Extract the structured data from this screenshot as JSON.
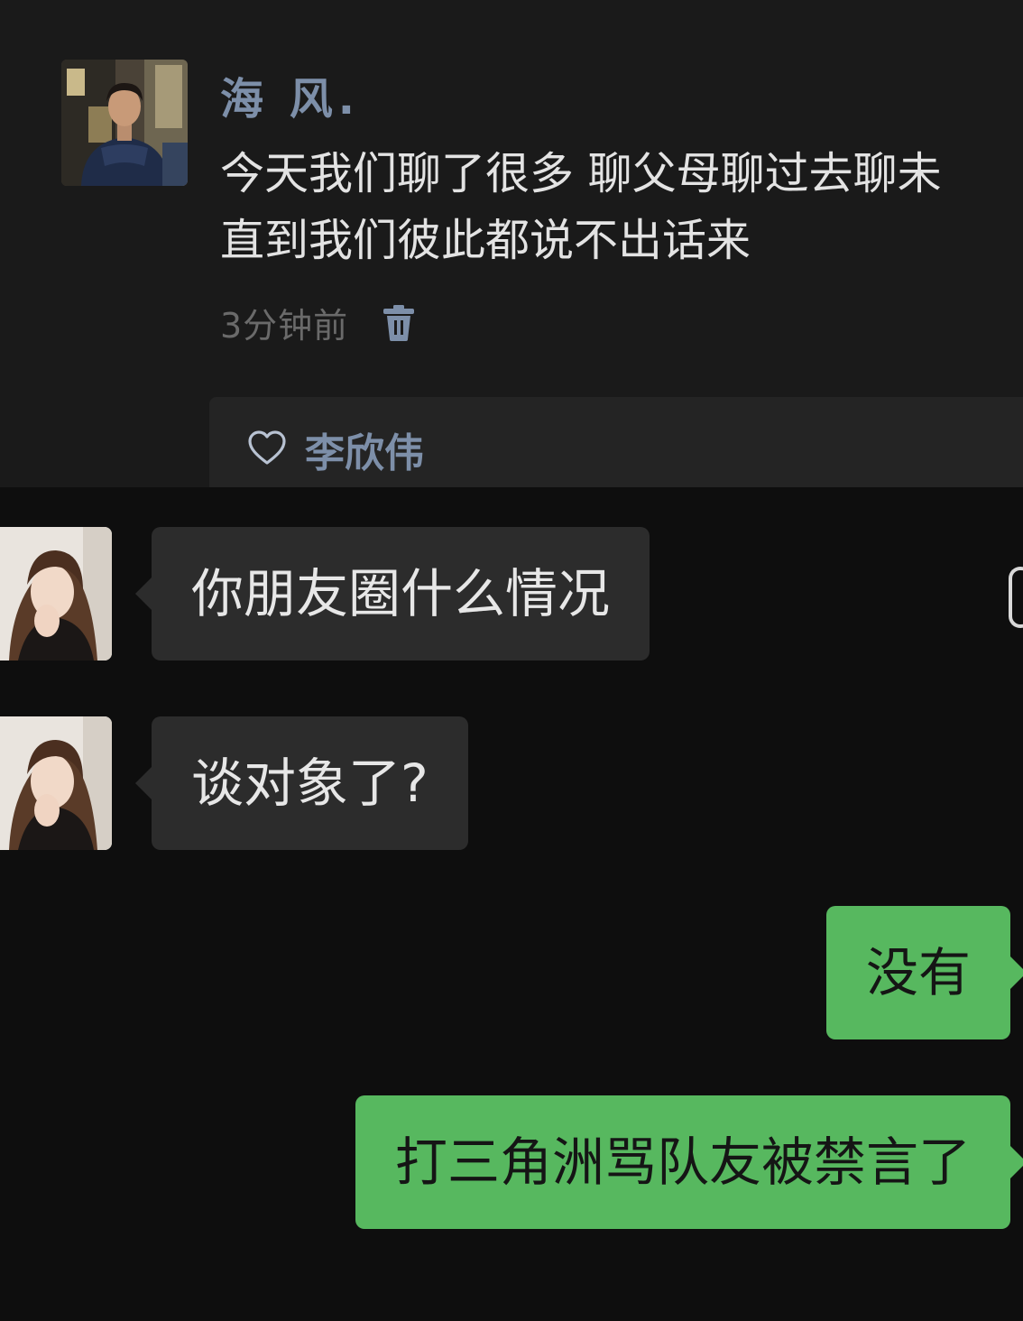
{
  "moment": {
    "author_name": "海 风.",
    "text_lines": [
      "今天我们聊了很多 聊父母聊过去聊未",
      "直到我们彼此都说不出话来"
    ],
    "timestamp": "3分钟前",
    "delete_icon": "trash-icon",
    "like_icon": "heart-icon",
    "liked_by": "李欣伟"
  },
  "chat": {
    "messages": [
      {
        "from": "contact",
        "text": "你朋友圈什么情况"
      },
      {
        "from": "contact",
        "text": "谈对象了?"
      },
      {
        "from": "me",
        "text": "没有"
      },
      {
        "from": "me",
        "text": "打三角洲骂队友被禁言了"
      }
    ]
  },
  "colors": {
    "background": "#0e0e0e",
    "moment_panel": "#1a1a1a",
    "name_blue": "#7d8fa9",
    "incoming_bubble": "#2c2c2c",
    "outgoing_bubble": "#57b85f"
  }
}
